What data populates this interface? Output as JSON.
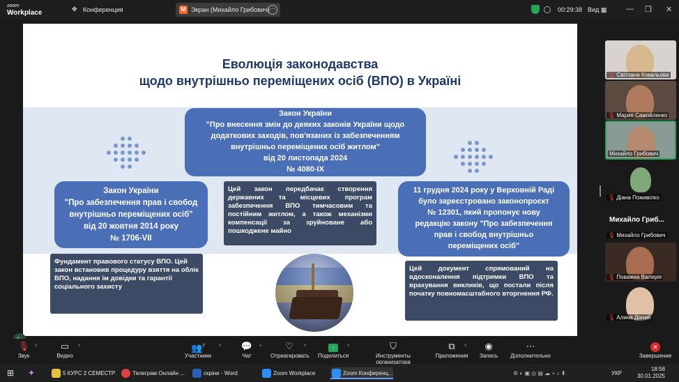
{
  "topbar": {
    "logo_line1": "zoom",
    "logo_line2": "Workplace",
    "conference_label": "Конференция",
    "screen_share_label": "Экран (Михайло Грибович)",
    "screen_share_badge": "M",
    "timer": "00:29:38",
    "view_label": "Вид"
  },
  "slide": {
    "title_line1": "Еволюція законодавства",
    "title_line2": "щодо внутрішньо переміщених осіб (ВПО) в Україні",
    "law_2024": {
      "l1": "Закон України",
      "l2": "\"Про внесення змін до деяких законів України щодо",
      "l3": "додаткових заходів, пов'язаних із забезпеченням",
      "l4": "внутрішньо переміщених осіб житлом\"",
      "l5": "від 20 листопада 2024",
      "l6": "№ 4080-IX"
    },
    "law_2014": {
      "l1": "Закон України",
      "l2": "\"Про забезпечення прав і свобод",
      "l3": "внутрішньо переміщених осіб\"",
      "l4": "від 20 жовтня 2014 року",
      "l5": "№ 1706-VII"
    },
    "law_2014_desc": "Фундамент правового статусу ВПО. Цей закон встановив процедуру взяття на облік ВПО, надання їм довідки та гарантії соціального захисту",
    "law_2024_desc": "Цей закон передбачає створення державних та місцевих програм забезпечення ВПО тимчасовим та постійним житлом, а також механізми компенсації за зруйноване або пошкоджене майно",
    "bill_2024": {
      "l1": "11 грудня 2024 року у Верховній Раді",
      "l2": "було зареєстровано законопроєкт",
      "l3": "№ 12301, який пропонує нову",
      "l4": "редакцію закону \"Про забезпечення",
      "l5": "прав і свобод внутрішньо",
      "l6": "переміщених осіб\""
    },
    "bill_2024_desc": "Цей документ спрямований на вдосконалення підтримки ВПО та врахування викликів, що постали після початку повномасштабного вторгнення РФ."
  },
  "participants": [
    {
      "name": "Світлана Ковальова"
    },
    {
      "name": "Мария Самойленко"
    },
    {
      "name": "Михайло Грибович"
    },
    {
      "name": "Діана Поживілко"
    }
  ],
  "section_title": "Михайло Гриб...",
  "participants_audio": [
    {
      "name": "Михайло Грибович"
    },
    {
      "name": "Поважна Валерія"
    },
    {
      "name": "Алина Доний"
    }
  ],
  "toolbar": {
    "sound": "Звук",
    "video": "Видео",
    "participants": "Участники",
    "participants_count": "7",
    "chat": "Чат",
    "react": "Отреагировать",
    "share": "Поделиться",
    "host_tools": "Инструменты организатора",
    "apps": "Приложения",
    "record": "Запись",
    "more": "Дополнительно",
    "end": "Завершение"
  },
  "taskbar": {
    "items": [
      "5 КУРС 2 СЕМЕСТР",
      "Телеграм Онлайн ...",
      "скріни - Word",
      "Zoom Workplace",
      "Zoom Конференц..."
    ],
    "lang": "УКР",
    "time": "18:58",
    "date": "30.01.2025"
  },
  "colors": {
    "accent_green": "#23a55a",
    "slide_blue": "#4a6fb7",
    "slide_dark": "#3c4a66",
    "title_navy": "#1f3864",
    "end_red": "#e02828"
  }
}
